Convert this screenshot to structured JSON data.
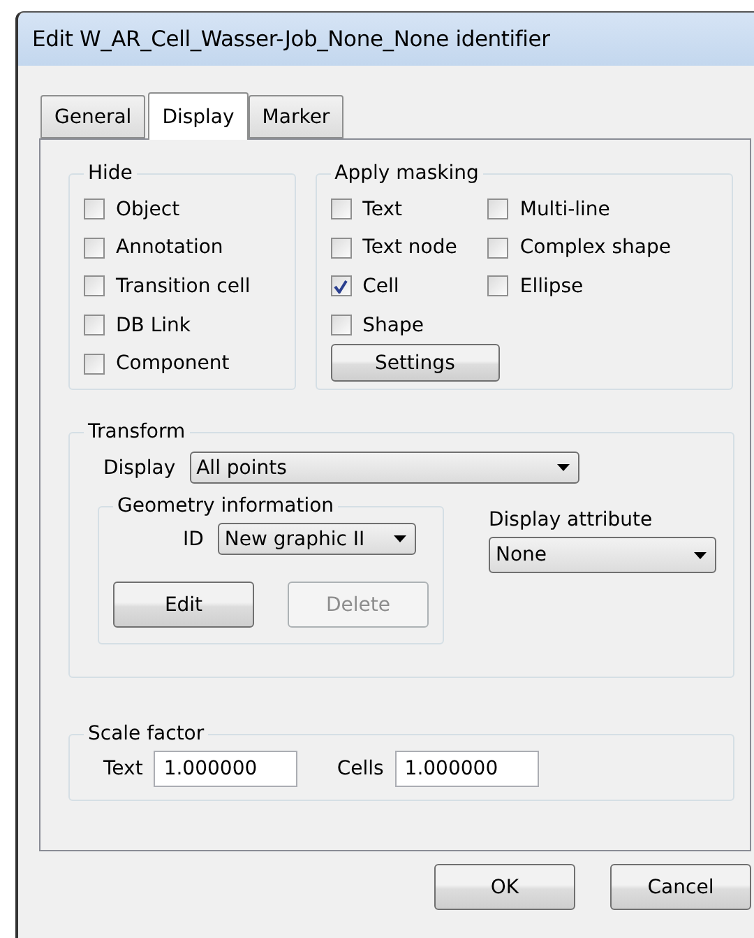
{
  "window": {
    "title": "Edit W_AR_Cell_Wasser-Job_None_None identifier"
  },
  "tabs": [
    {
      "label": "General",
      "selected": false
    },
    {
      "label": "Display",
      "selected": true
    },
    {
      "label": "Marker",
      "selected": false
    }
  ],
  "hide": {
    "title": "Hide",
    "options": [
      {
        "label": "Object",
        "checked": false
      },
      {
        "label": "Annotation",
        "checked": false
      },
      {
        "label": "Transition cell",
        "checked": false
      },
      {
        "label": "DB Link",
        "checked": false
      },
      {
        "label": "Component",
        "checked": false
      }
    ]
  },
  "masking": {
    "title": "Apply masking",
    "options": [
      {
        "label": "Text",
        "checked": false
      },
      {
        "label": "Text node",
        "checked": false
      },
      {
        "label": "Cell",
        "checked": true
      },
      {
        "label": "Shape",
        "checked": false
      },
      {
        "label": "Multi-line",
        "checked": false
      },
      {
        "label": "Complex shape",
        "checked": false
      },
      {
        "label": "Ellipse",
        "checked": false
      }
    ],
    "button": "Settings"
  },
  "transform": {
    "title": "Transform",
    "display_label": "Display",
    "display_value": "All points",
    "geometry": {
      "title": "Geometry information",
      "id_label": "ID",
      "id_value": "New graphic II",
      "buttons": [
        {
          "label": "Edit",
          "disabled": false
        },
        {
          "label": "Delete",
          "disabled": true
        }
      ]
    },
    "attribute_label": "Display attribute",
    "attribute_value": "None"
  },
  "scale": {
    "title": "Scale factor",
    "fields": [
      {
        "label": "Text",
        "value": "1.000000"
      },
      {
        "label": "Cells",
        "value": "1.000000"
      }
    ]
  },
  "buttons": [
    "OK",
    "Cancel"
  ]
}
